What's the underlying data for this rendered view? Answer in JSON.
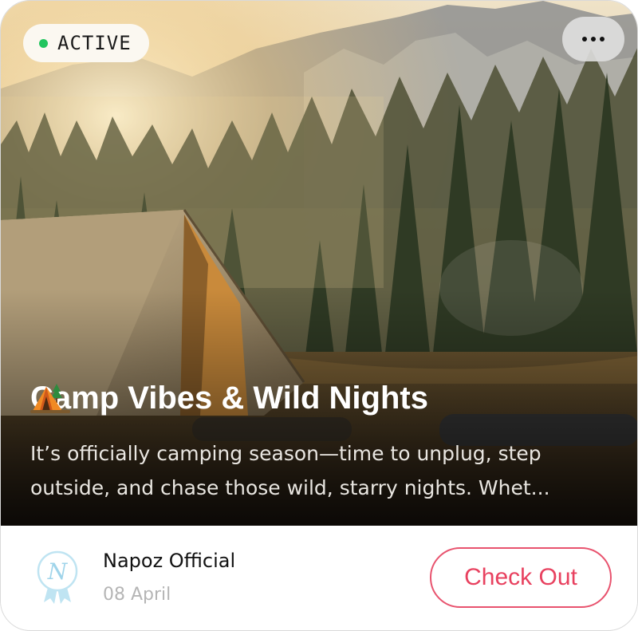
{
  "card": {
    "status": {
      "label": "ACTIVE",
      "dot_color": "#22c55e"
    },
    "menu": {
      "icon": "more-horizontal-icon"
    },
    "hero": {
      "title": "Camp Vibes & Wild Nights",
      "title_emoji": "tent-emoji",
      "description": "It’s officially camping season—time to unplug, step outside, and chase those wild, starry nights. Whet..."
    },
    "author": {
      "name": "Napoz Official",
      "date": "08 April",
      "logo": "napoz-badge-logo"
    },
    "cta": {
      "label": "Check Out",
      "color": "#e8415f"
    }
  }
}
